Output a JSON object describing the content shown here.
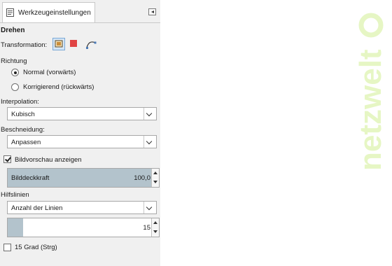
{
  "tab": {
    "label": "Werkzeugeinstellungen",
    "icon": "tool-options-icon"
  },
  "collapse_icon": "collapse-left-icon",
  "tool": {
    "title": "Drehen"
  },
  "transformation": {
    "label": "Transformation:",
    "buttons": [
      {
        "icon": "layer-icon",
        "active": true
      },
      {
        "icon": "selection-icon",
        "active": false
      },
      {
        "icon": "path-icon",
        "active": false
      }
    ]
  },
  "direction": {
    "label": "Richtung",
    "options": [
      {
        "label": "Normal (vorwärts)",
        "selected": true
      },
      {
        "label": "Korrigierend (rückwärts)",
        "selected": false
      }
    ]
  },
  "interpolation": {
    "label": "Interpolation:",
    "value": "Kubisch"
  },
  "clipping": {
    "label": "Beschneidung:",
    "value": "Anpassen"
  },
  "preview": {
    "label": "Bildvorschau anzeigen",
    "checked": true
  },
  "opacity": {
    "label": "Bilddeckkraft",
    "value": "100,0",
    "fraction": 1.0
  },
  "guides": {
    "label": "Hilfslinien",
    "value": "Anzahl der Linien"
  },
  "lines": {
    "value": "15"
  },
  "angle15": {
    "label": "15 Grad (Strg)",
    "checked": false
  },
  "brand": {
    "text": "netzwelt",
    "color": "#e6f6c4"
  }
}
